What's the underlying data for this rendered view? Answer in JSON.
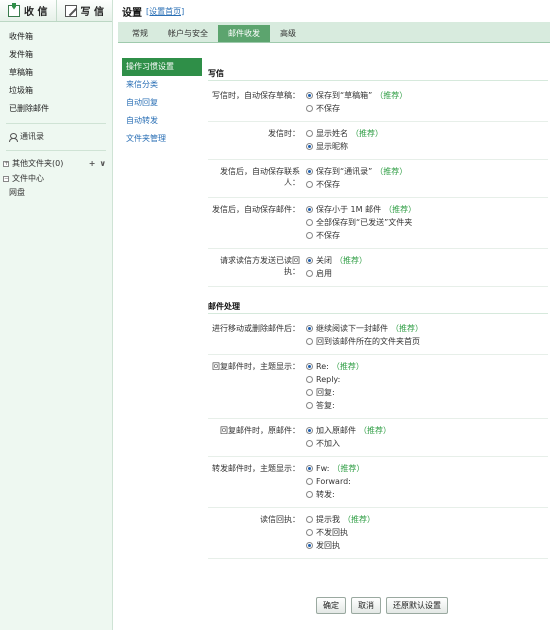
{
  "toolbar": {
    "inbox_label": "收 信",
    "compose_label": "写 信"
  },
  "sidebar": {
    "items": [
      "收件箱",
      "发件箱",
      "草稿箱",
      "垃圾箱",
      "已删除邮件"
    ],
    "contacts_label": "通讯录",
    "other_folders_label": "其他文件夹(0)",
    "other_folders_actions": [
      "+",
      "∨"
    ],
    "file_center_label": "文件中心",
    "netdisk_label": "网盘"
  },
  "header": {
    "title": "设置",
    "link": "[设置首页]"
  },
  "tabs": [
    {
      "label": "常规",
      "active": false
    },
    {
      "label": "帐户与安全",
      "active": false
    },
    {
      "label": "邮件收发",
      "active": true
    },
    {
      "label": "高级",
      "active": false
    }
  ],
  "subnav": [
    {
      "label": "操作习惯设置",
      "active": true
    },
    {
      "label": "来信分类",
      "active": false
    },
    {
      "label": "自动回复",
      "active": false
    },
    {
      "label": "自动转发",
      "active": false
    },
    {
      "label": "文件夹管理",
      "active": false
    }
  ],
  "sections": [
    {
      "title": "写信",
      "rows": [
        {
          "label": "写信时，自动保存草稿：",
          "options": [
            {
              "text": "保存到“草稿箱”",
              "rec": "（推荐）",
              "checked": true
            },
            {
              "text": "不保存",
              "rec": "",
              "checked": false
            }
          ]
        },
        {
          "label": "发信时：",
          "options": [
            {
              "text": "显示姓名",
              "rec": "（推荐）",
              "checked": false
            },
            {
              "text": "显示昵称",
              "rec": "",
              "checked": true
            }
          ]
        },
        {
          "label": "发信后，自动保存联系人：",
          "options": [
            {
              "text": "保存到“通讯录”",
              "rec": "（推荐）",
              "checked": true
            },
            {
              "text": "不保存",
              "rec": "",
              "checked": false
            }
          ]
        },
        {
          "label": "发信后，自动保存邮件：",
          "options": [
            {
              "text": "保存小于 1M 邮件",
              "rec": "（推荐）",
              "checked": true
            },
            {
              "text": "全部保存到“已发送”文件夹",
              "rec": "",
              "checked": false
            },
            {
              "text": "不保存",
              "rec": "",
              "checked": false
            }
          ]
        },
        {
          "label": "请求读信方发送已读回执：",
          "options": [
            {
              "text": "关闭",
              "rec": "（推荐）",
              "checked": true
            },
            {
              "text": "启用",
              "rec": "",
              "checked": false
            }
          ]
        }
      ]
    },
    {
      "title": "邮件处理",
      "rows": [
        {
          "label": "进行移动或删除邮件后：",
          "options": [
            {
              "text": "继续阅读下一封邮件",
              "rec": "（推荐）",
              "checked": true
            },
            {
              "text": "回到该邮件所在的文件夹首页",
              "rec": "",
              "checked": false
            }
          ]
        },
        {
          "label": "回复邮件时，主题显示：",
          "options": [
            {
              "text": "Re:",
              "rec": "（推荐）",
              "checked": true
            },
            {
              "text": "Reply:",
              "rec": "",
              "checked": false
            },
            {
              "text": "回复:",
              "rec": "",
              "checked": false
            },
            {
              "text": "答复:",
              "rec": "",
              "checked": false
            }
          ]
        },
        {
          "label": "回复邮件时，原邮件：",
          "options": [
            {
              "text": "加入原邮件",
              "rec": "（推荐）",
              "checked": true
            },
            {
              "text": "不加入",
              "rec": "",
              "checked": false
            }
          ]
        },
        {
          "label": "转发邮件时，主题显示：",
          "options": [
            {
              "text": "Fw:",
              "rec": "（推荐）",
              "checked": true
            },
            {
              "text": "Forward:",
              "rec": "",
              "checked": false
            },
            {
              "text": "转发:",
              "rec": "",
              "checked": false
            }
          ]
        },
        {
          "label": "读信回执：",
          "options": [
            {
              "text": "提示我",
              "rec": "（推荐）",
              "checked": false
            },
            {
              "text": "不发回执",
              "rec": "",
              "checked": false
            },
            {
              "text": "发回执",
              "rec": "",
              "checked": true
            }
          ]
        }
      ]
    }
  ],
  "buttons": {
    "ok": "确定",
    "cancel": "取消",
    "default": "还原默认设置"
  }
}
